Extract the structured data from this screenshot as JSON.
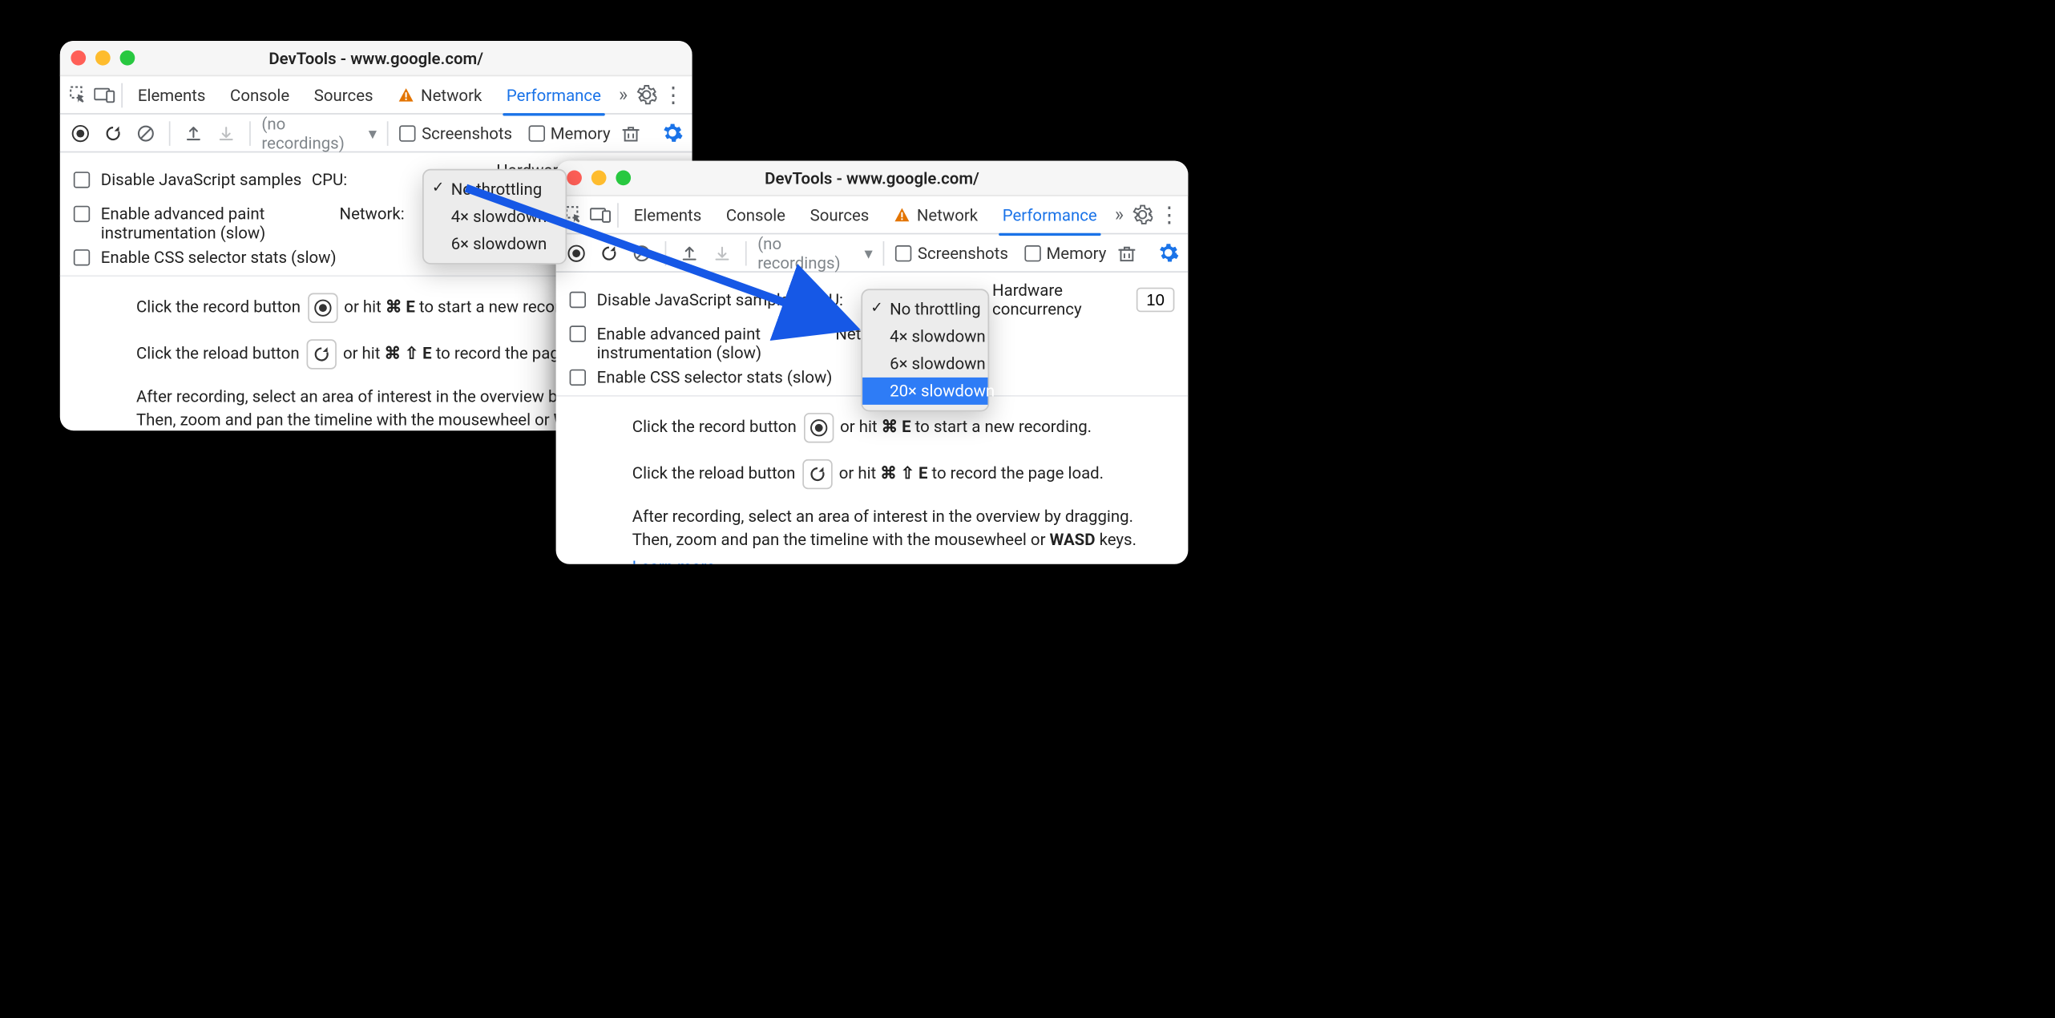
{
  "window_title": "DevTools - www.google.com/",
  "tabs": {
    "elements": "Elements",
    "console": "Console",
    "sources": "Sources",
    "network": "Network",
    "performance": "Performance"
  },
  "toolbar": {
    "no_recordings": "(no recordings)",
    "screenshots": "Screenshots",
    "memory": "Memory"
  },
  "settings": {
    "disable_js": "Disable JavaScript samples",
    "adv_paint": "Enable advanced paint instrumentation (slow)",
    "css_selector": "Enable CSS selector stats (slow)",
    "cpu_label": "CPU:",
    "network_label": "Network:",
    "hw_concurrency": "Hardware concurrency",
    "hw_value": "10"
  },
  "cpu_menu": {
    "no_throttling": "No throttling",
    "x4": "4× slowdown",
    "x6": "6× slowdown",
    "x20": "20× slowdown"
  },
  "help": {
    "record_pre": "Click the record button ",
    "record_post": " or hit ",
    "record_keys": "⌘ E",
    "record_tail": " to start a new recording.",
    "reload_pre": "Click the reload button ",
    "reload_post": " or hit ",
    "reload_keys": "⌘ ⇧ E",
    "reload_tail": " to record the page load.",
    "after_1": "After recording, select an area of interest in the overview by dragging.",
    "after_2a": "Then, zoom and pan the timeline with the mousewheel or ",
    "after_2b": "WASD",
    "after_2c": " keys.",
    "learn_more": "Learn more",
    "after_1_trunc": "After recording, select an area of interest in the overview by drag",
    "after_2a_trunc": "Then, zoom and pan the timeline with the mousewheel or ",
    "reload_tail_trunc": " to record the page loa"
  }
}
